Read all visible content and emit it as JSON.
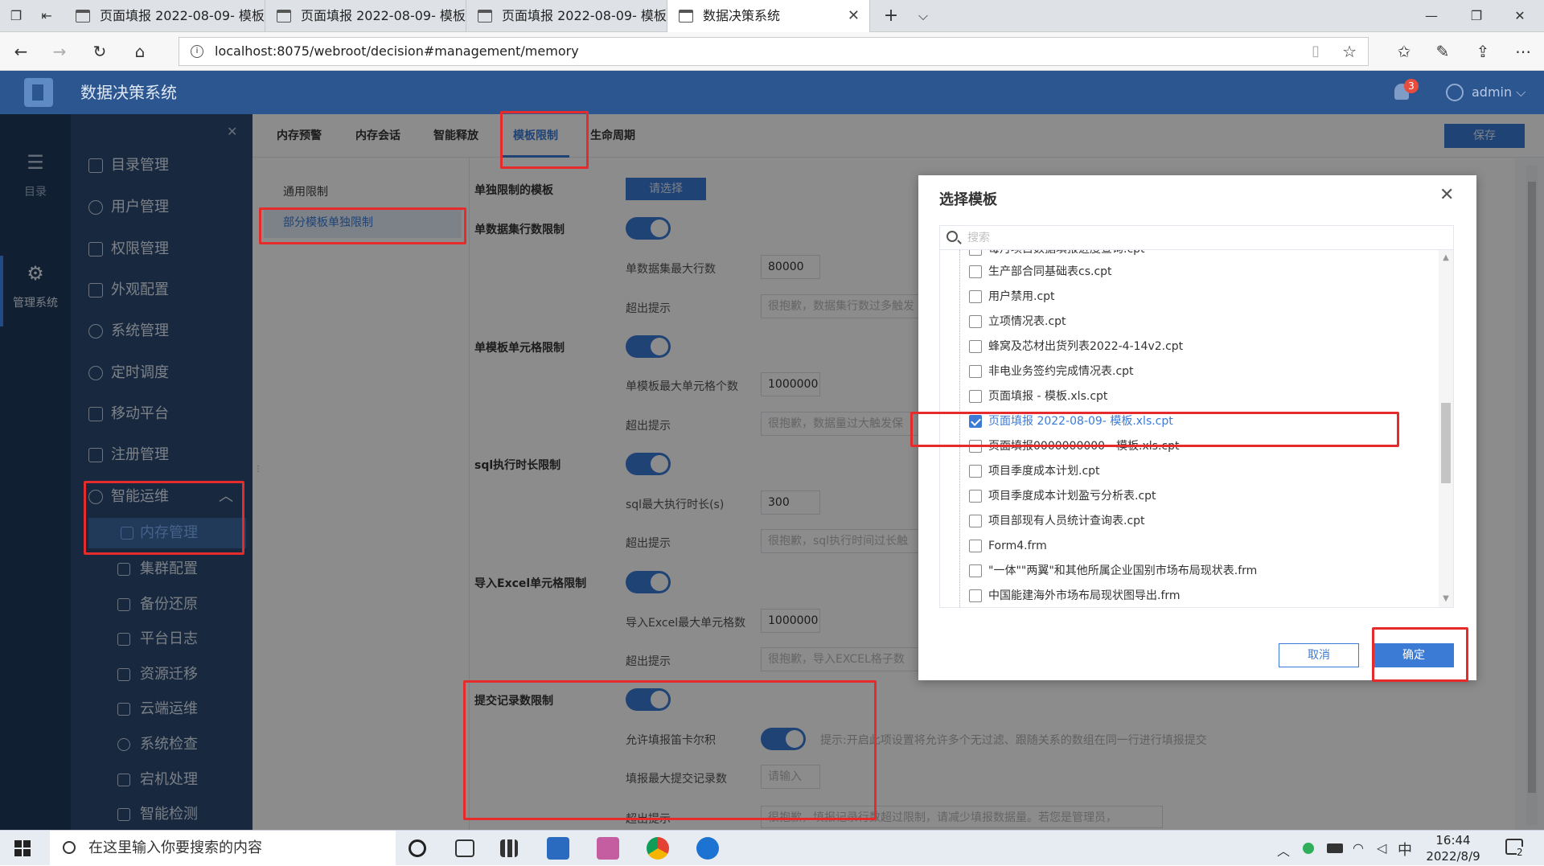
{
  "browser": {
    "tabs": [
      {
        "title": "页面填报 2022-08-09- 模板"
      },
      {
        "title": "页面填报 2022-08-09- 模板"
      },
      {
        "title": "页面填报 2022-08-09- 模板"
      },
      {
        "title": "数据决策系统"
      }
    ],
    "new_tab": "+",
    "tab_menu": "⌵",
    "url": "localhost:8075/webroot/decision#management/memory",
    "window_controls": {
      "minimize": "—",
      "maximize": "❐",
      "close": "✕"
    }
  },
  "app": {
    "title": "数据决策系统",
    "notification_count": "3",
    "user": "admin",
    "brand_color": "#2c5690",
    "accent_color": "#3b7bd6"
  },
  "rail": {
    "items": [
      {
        "label": "目录",
        "icon": "list-icon"
      },
      {
        "label": "管理系统",
        "icon": "gear-icon"
      }
    ]
  },
  "sidebar": {
    "items": [
      {
        "label": "目录管理"
      },
      {
        "label": "用户管理"
      },
      {
        "label": "权限管理"
      },
      {
        "label": "外观配置"
      },
      {
        "label": "系统管理"
      },
      {
        "label": "定时调度"
      },
      {
        "label": "移动平台"
      },
      {
        "label": "注册管理"
      },
      {
        "label": "智能运维"
      }
    ],
    "sub_items": [
      {
        "label": "内存管理"
      },
      {
        "label": "集群配置"
      },
      {
        "label": "备份还原"
      },
      {
        "label": "平台日志"
      },
      {
        "label": "资源迁移"
      },
      {
        "label": "云端运维"
      },
      {
        "label": "系统检查"
      },
      {
        "label": "宕机处理"
      },
      {
        "label": "智能检测"
      }
    ]
  },
  "content": {
    "tabs": [
      {
        "label": "内存预警"
      },
      {
        "label": "内存会话"
      },
      {
        "label": "智能释放"
      },
      {
        "label": "模板限制"
      },
      {
        "label": "生命周期"
      }
    ],
    "save_label": "保存",
    "left_menu": [
      {
        "label": "通用限制"
      },
      {
        "label": "部分模板单独限制"
      }
    ],
    "select_template_label": "单独限制的模板",
    "select_button": "请选择",
    "sections": [
      {
        "label": "单数据集行数限制",
        "rows": [
          {
            "label": "单数据集最大行数",
            "value": "80000"
          },
          {
            "label": "超出提示",
            "placeholder": "很抱歉，数据集行数过多触发"
          }
        ]
      },
      {
        "label": "单模板单元格限制",
        "rows": [
          {
            "label": "单模板最大单元格个数",
            "value": "1000000"
          },
          {
            "label": "超出提示",
            "placeholder": "很抱歉，数据量过大触发保"
          }
        ]
      },
      {
        "label": "sql执行时长限制",
        "rows": [
          {
            "label": "sql最大执行时长(s)",
            "value": "300"
          },
          {
            "label": "超出提示",
            "placeholder": "很抱歉，sql执行时间过长触"
          }
        ]
      },
      {
        "label": "导入Excel单元格限制",
        "rows": [
          {
            "label": "导入Excel最大单元格数",
            "value": "1000000"
          },
          {
            "label": "超出提示",
            "placeholder": "很抱歉，导入EXCEL格子数"
          }
        ]
      },
      {
        "label": "提交记录数限制",
        "rows": [
          {
            "label": "允许填报笛卡尔积",
            "hint": "提示:开启此项设置将允许多个无过滤、跟随关系的数组在同一行进行填报提交"
          },
          {
            "label": "填报最大提交记录数",
            "placeholder": "请输入"
          },
          {
            "label": "超出提示",
            "placeholder": "很抱歉，填报记录行数超过限制，请减少填报数据量。若您是管理员，"
          }
        ]
      }
    ]
  },
  "dialog": {
    "title": "选择模板",
    "search_placeholder": "搜索",
    "items": [
      {
        "label": "每月项目数据填报进度查询.cpt",
        "checked": false
      },
      {
        "label": "生产部合同基础表cs.cpt",
        "checked": false
      },
      {
        "label": "用户禁用.cpt",
        "checked": false
      },
      {
        "label": "立项情况表.cpt",
        "checked": false
      },
      {
        "label": "蜂窝及芯材出货列表2022-4-14v2.cpt",
        "checked": false
      },
      {
        "label": "非电业务签约完成情况表.cpt",
        "checked": false
      },
      {
        "label": "页面填报 - 模板.xls.cpt",
        "checked": false
      },
      {
        "label": "页面填报 2022-08-09- 模板.xls.cpt",
        "checked": true
      },
      {
        "label": "页面填报0000000000 - 模板.xls.cpt",
        "checked": false
      },
      {
        "label": "项目季度成本计划.cpt",
        "checked": false
      },
      {
        "label": "项目季度成本计划盈亏分析表.cpt",
        "checked": false
      },
      {
        "label": "项目部现有人员统计查询表.cpt",
        "checked": false
      },
      {
        "label": "Form4.frm",
        "checked": false
      },
      {
        "label": "\"一体\"\"两翼\"和其他所属企业国别市场布局现状表.frm",
        "checked": false
      },
      {
        "label": "中国能建海外市场布局现状图导出.frm",
        "checked": false
      }
    ],
    "cancel_label": "取消",
    "confirm_label": "确定"
  },
  "taskbar": {
    "search_placeholder": "在这里输入你要搜索的内容",
    "time": "16:44",
    "date": "2022/8/9",
    "ime": "中",
    "notification_count": "2"
  }
}
